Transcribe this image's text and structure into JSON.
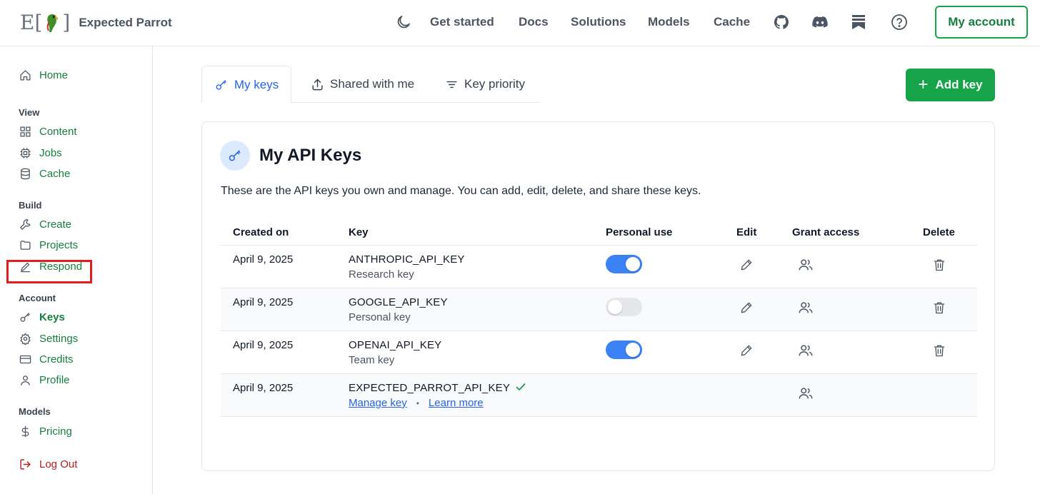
{
  "brand": {
    "logo_letter": "E",
    "logo_bracket_left": "[",
    "logo_bracket_right": "]",
    "name": "Expected Parrot"
  },
  "nav": {
    "links": [
      "Get started",
      "Docs",
      "Solutions",
      "Models",
      "Cache"
    ],
    "icons": [
      "moon-icon",
      "github-icon",
      "discord-icon",
      "blog-icon",
      "help-icon"
    ],
    "account_label": "My account"
  },
  "sidebar": {
    "home": "Home",
    "sections": {
      "view": {
        "title": "View",
        "items": [
          "Content",
          "Jobs",
          "Cache"
        ]
      },
      "build": {
        "title": "Build",
        "items": [
          "Create",
          "Projects",
          "Respond"
        ]
      },
      "account": {
        "title": "Account",
        "items": [
          "Keys",
          "Settings",
          "Credits",
          "Profile"
        ]
      },
      "models": {
        "title": "Models",
        "items": [
          "Pricing"
        ]
      }
    },
    "logout": "Log Out",
    "active_item": "Keys"
  },
  "tabs": [
    {
      "label": "My keys",
      "icon": "key-icon",
      "active": true
    },
    {
      "label": "Shared with me",
      "icon": "share-icon",
      "active": false
    },
    {
      "label": "Key priority",
      "icon": "filter-icon",
      "active": false
    }
  ],
  "add_key_label": "Add key",
  "card": {
    "title": "My API Keys",
    "description": "These are the API keys you own and manage. You can add, edit, delete, and share these keys."
  },
  "table": {
    "headers": [
      "Created on",
      "Key",
      "Personal use",
      "Edit",
      "Grant access",
      "Delete"
    ],
    "rows": [
      {
        "created": "April 9, 2025",
        "key": "ANTHROPIC_API_KEY",
        "desc": "Research key",
        "personal_use": true
      },
      {
        "created": "April 9, 2025",
        "key": "GOOGLE_API_KEY",
        "desc": "Personal key",
        "personal_use": false
      },
      {
        "created": "April 9, 2025",
        "key": "OPENAI_API_KEY",
        "desc": "Team key",
        "personal_use": true
      },
      {
        "created": "April 9, 2025",
        "key": "EXPECTED_PARROT_API_KEY",
        "verified": true,
        "manage_label": "Manage key",
        "learn_label": "Learn more",
        "separator": "•"
      }
    ]
  },
  "colors": {
    "brand_green": "#16a34a",
    "link_blue": "#2563eb",
    "toggle_on": "#3b82f6",
    "highlight_red": "#e11d1d",
    "logout_red": "#b91c1c"
  }
}
